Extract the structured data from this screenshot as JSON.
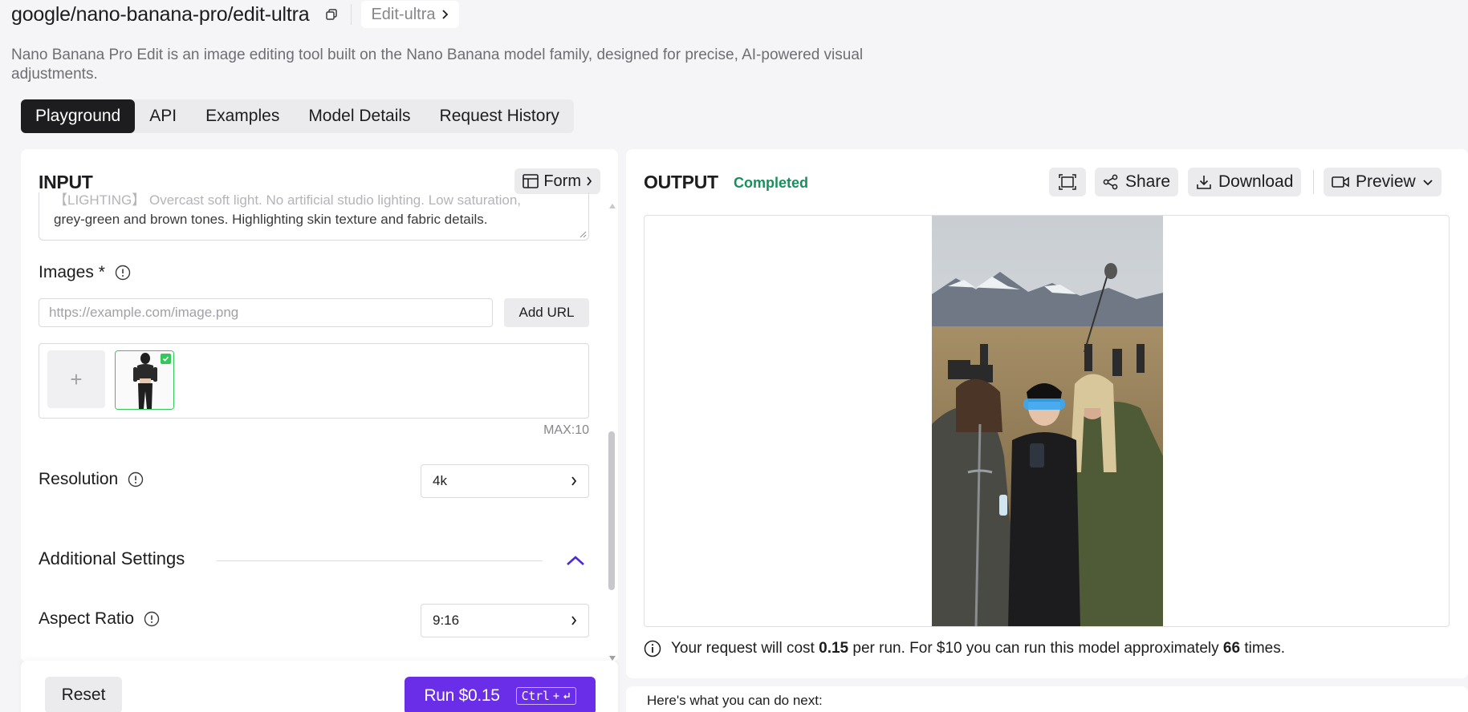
{
  "header": {
    "model_name": "google/nano-banana-pro/edit-ultra",
    "variant": "Edit-ultra",
    "description": "Nano Banana Pro Edit is an image editing tool built on the Nano Banana model family, designed for precise, AI-powered visual adjustments."
  },
  "tabs": [
    {
      "label": "Playground",
      "active": true
    },
    {
      "label": "API",
      "active": false
    },
    {
      "label": "Examples",
      "active": false
    },
    {
      "label": "Model Details",
      "active": false
    },
    {
      "label": "Request History",
      "active": false
    }
  ],
  "input": {
    "title": "INPUT",
    "form_toggle": "Form",
    "prompt_line1": "【LIGHTING】 Overcast soft light. No artificial studio lighting. Low saturation,",
    "prompt_line2": "grey-green and brown tones. Highlighting skin texture and fabric details.",
    "images_label": "Images *",
    "url_placeholder": "https://example.com/image.png",
    "add_url": "Add URL",
    "add_image_symbol": "+",
    "max_label": "MAX:10",
    "resolution_label": "Resolution",
    "resolution_value": "4k",
    "additional_settings": "Additional Settings",
    "aspect_ratio_label": "Aspect Ratio",
    "aspect_ratio_value": "9:16"
  },
  "footer": {
    "reset": "Reset",
    "run": "Run $0.15",
    "shortcut": "Ctrl"
  },
  "output": {
    "title": "OUTPUT",
    "status": "Completed",
    "share": "Share",
    "download": "Download",
    "preview": "Preview",
    "cost_prefix": "Your request will cost",
    "cost_value": "0.15",
    "cost_mid": "per run. For $10 you can run this model approximately",
    "runs_value": "66",
    "cost_suffix": "times.",
    "next_steps": "Here's what you can do next:"
  },
  "colors": {
    "accent": "#6a2ee8",
    "status_green": "#16915b",
    "selected_border": "#34c759",
    "tab_active": "#1d1d1f"
  },
  "icons": [
    "copy-icon",
    "chevron-right-icon",
    "table-icon",
    "info-icon",
    "plus-icon",
    "check-icon",
    "chevron-up-icon",
    "expand-icon",
    "share-icon",
    "download-icon",
    "video-icon",
    "chevron-down-icon",
    "enter-icon"
  ]
}
